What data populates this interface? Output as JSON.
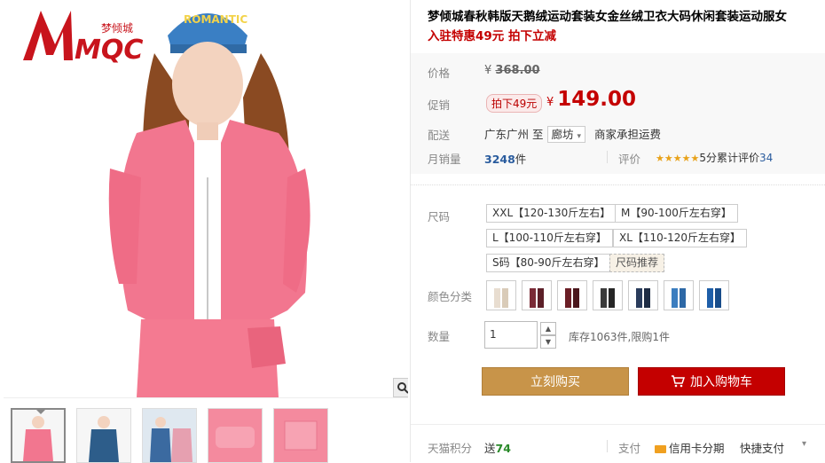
{
  "product": {
    "title": "梦倾城春秋韩版天鹅绒运动套装女金丝绒卫衣大码休闲套装运动服女",
    "promo": "入驻特惠49元 拍下立减"
  },
  "brand": {
    "logo_text": "MQC",
    "logo_cn": "梦倾城",
    "cap_text": "ROMANTIC"
  },
  "price": {
    "label": "价格",
    "currency": "¥",
    "original": "368.00",
    "promo_label": "促销",
    "promo_tag": "拍下49元",
    "current": "149.00"
  },
  "shipping": {
    "label": "配送",
    "from": "广东广州",
    "to_word": "至",
    "destination": "廊坊",
    "note": "商家承担运费"
  },
  "sales": {
    "label": "月销量",
    "count": "3248",
    "unit": "件",
    "review_label": "评价",
    "stars": "★★★★★",
    "score_text": "5分累计评价",
    "review_count": "34"
  },
  "size": {
    "label": "尺码",
    "options": [
      "XXL【120-130斤左右】",
      "M【90-100斤左右穿】",
      "L【100-110斤左右穿】",
      "XL【110-120斤左右穿】",
      "S码【80-90斤左右穿】"
    ],
    "recommend": "尺码推荐"
  },
  "color": {
    "label": "颜色分类",
    "swatches": [
      "#e8ddd0",
      "#7a2a36",
      "#6b1e26",
      "#3b3b3b",
      "#2a3c5c",
      "#3b7dbf",
      "#1e5ea8"
    ]
  },
  "quantity": {
    "label": "数量",
    "value": "1",
    "stock": "库存1063件,限购1件"
  },
  "buttons": {
    "buy": "立刻购买",
    "cart": "加入购物车"
  },
  "footer": {
    "points_label": "天猫积分",
    "points_prefix": "送",
    "points_value": "74",
    "pay_label": "支付",
    "credit": "信用卡分期",
    "quick": "快捷支付"
  },
  "colors": {
    "accent_red": "#c40000",
    "buy_gold": "#c89449"
  }
}
